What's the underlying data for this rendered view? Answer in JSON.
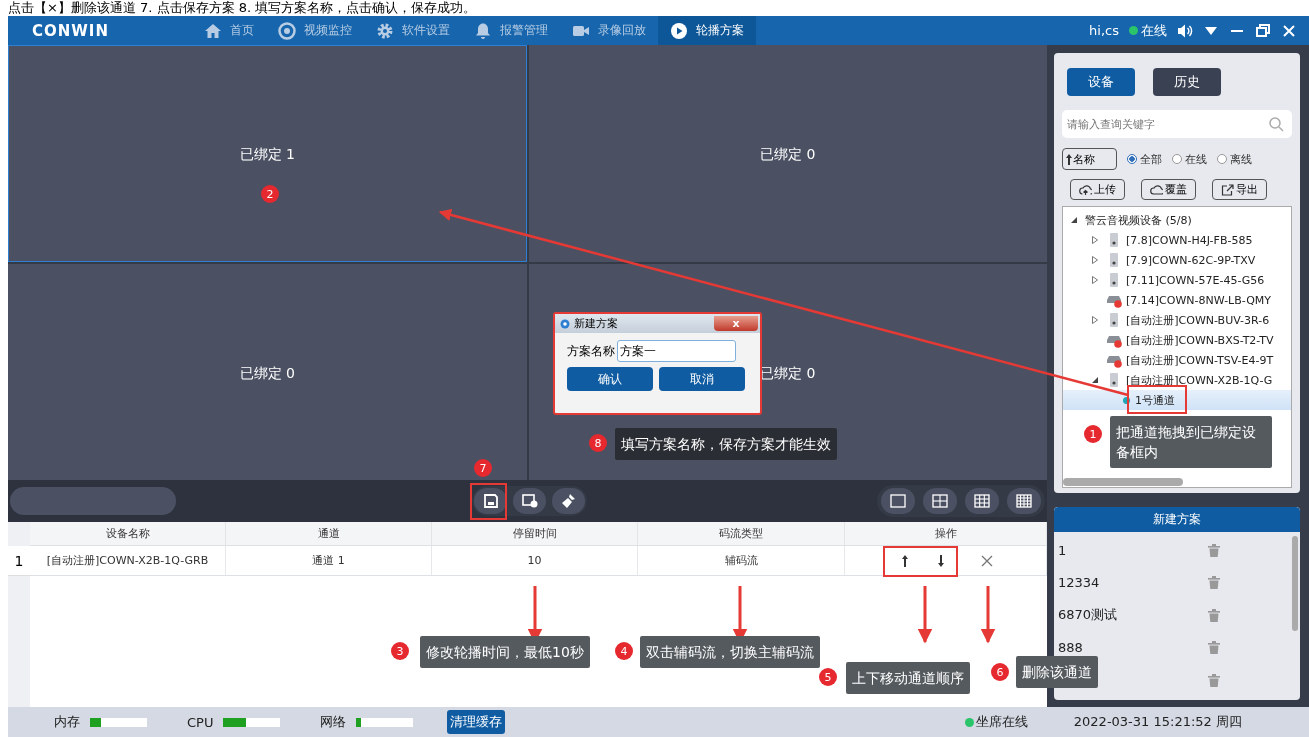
{
  "doc_caption": "点击【×】删除该通道    7. 点击保存方案    8. 填写方案名称，点击确认，保存成功。",
  "header": {
    "logo": "CONWIN",
    "nav": [
      {
        "label": "首页",
        "selected": false
      },
      {
        "label": "视频监控",
        "selected": false
      },
      {
        "label": "软件设置",
        "selected": false
      },
      {
        "label": "报警管理",
        "selected": false
      },
      {
        "label": "录像回放",
        "selected": false
      },
      {
        "label": "轮播方案",
        "selected": true
      }
    ],
    "user": "hi,cs",
    "status": "在线"
  },
  "video_cells": [
    {
      "label": "已绑定 1",
      "selected": true
    },
    {
      "label": "已绑定 0",
      "selected": false
    },
    {
      "label": "已绑定 0",
      "selected": false
    },
    {
      "label": "已绑定 0",
      "selected": false
    }
  ],
  "layout_buttons": [
    {
      "kind": "single"
    },
    {
      "kind": "quad"
    },
    {
      "kind": "nine"
    },
    {
      "kind": "sixteen"
    }
  ],
  "table": {
    "columns": [
      "设备名称",
      "通道",
      "停留时间",
      "码流类型",
      "操作"
    ],
    "rows": [
      {
        "index": "1",
        "device": "[自动注册]COWN-X2B-1Q-GRB",
        "channel": "通道 1",
        "dwell": "10",
        "stream": "辅码流"
      }
    ]
  },
  "sidebar": {
    "tabs": [
      {
        "label": "设备",
        "selected": true
      },
      {
        "label": "历史",
        "selected": false
      }
    ],
    "search": {
      "placeholder": "请输入查询关键字"
    },
    "sort": "名称",
    "filters": [
      {
        "label": "全部",
        "selected": true
      },
      {
        "label": "在线",
        "selected": false
      },
      {
        "label": "离线",
        "selected": false
      }
    ],
    "actions": [
      "上传",
      "覆盖",
      "导出"
    ],
    "tree": [
      {
        "label": "警云音视频设备 (5/8)",
        "expanded": true,
        "selected": false,
        "children": [
          {
            "label": "[7.8]COWN-H4J-FB-585",
            "kind": "camera",
            "expanded": false,
            "selected": false
          },
          {
            "label": "[7.9]COWN-62C-9P-TXV",
            "kind": "camera",
            "expanded": false,
            "selected": false
          },
          {
            "label": "[7.11]COWN-57E-45-G56",
            "kind": "camera",
            "expanded": false,
            "selected": false
          },
          {
            "label": "[7.14]COWN-8NW-LB-QMY",
            "kind": "recorder",
            "offline": true,
            "selected": false
          },
          {
            "label": "[自动注册]COWN-BUV-3R-6",
            "kind": "camera",
            "expanded": false,
            "selected": false
          },
          {
            "label": "[自动注册]COWN-BXS-T2-TV",
            "kind": "recorder",
            "offline": true,
            "selected": false
          },
          {
            "label": "[自动注册]COWN-TSV-E4-9T",
            "kind": "recorder",
            "offline": true,
            "selected": false
          },
          {
            "label": "[自动注册]COWN-X2B-1Q-G",
            "kind": "camera",
            "expanded": true,
            "selected": false,
            "children": [
              {
                "label": "1号通道",
                "kind": "channel",
                "selected": true
              }
            ]
          }
        ]
      }
    ]
  },
  "plans": {
    "title": "新建方案",
    "items": [
      {
        "kind": "named",
        "name": "1"
      },
      {
        "kind": "named",
        "name": "12334"
      },
      {
        "kind": "named",
        "name": "6870测试"
      },
      {
        "kind": "named",
        "name": "888"
      },
      {
        "kind": "covered"
      }
    ]
  },
  "status_bar": {
    "meters": [
      {
        "label": "内存",
        "level": 0.2
      },
      {
        "label": "CPU",
        "level": 0.4
      },
      {
        "label": "网络",
        "level": 0.08
      }
    ],
    "clear_button": "清理缓存",
    "seat_status": "坐席在线",
    "datetime": "2022-03-31 15:21:52 周四"
  },
  "dialog": {
    "title": "新建方案",
    "close": "x",
    "field_label": "方案名称",
    "value": "方案一",
    "buttons": [
      "确认",
      "取消"
    ]
  },
  "annotations": [
    {
      "number": "1",
      "text": "把通道拖拽到已绑定设备框内"
    },
    {
      "number": "2"
    },
    {
      "number": "3",
      "text": "修改轮播时间，最低10秒"
    },
    {
      "number": "4",
      "text": "双击辅码流，切换主辅码流"
    },
    {
      "number": "5",
      "text": "上下移动通道顺序"
    },
    {
      "number": "6",
      "text": "删除该通道"
    },
    {
      "number": "7"
    },
    {
      "number": "8",
      "text": "填写方案名称，保存方案才能生效"
    }
  ]
}
